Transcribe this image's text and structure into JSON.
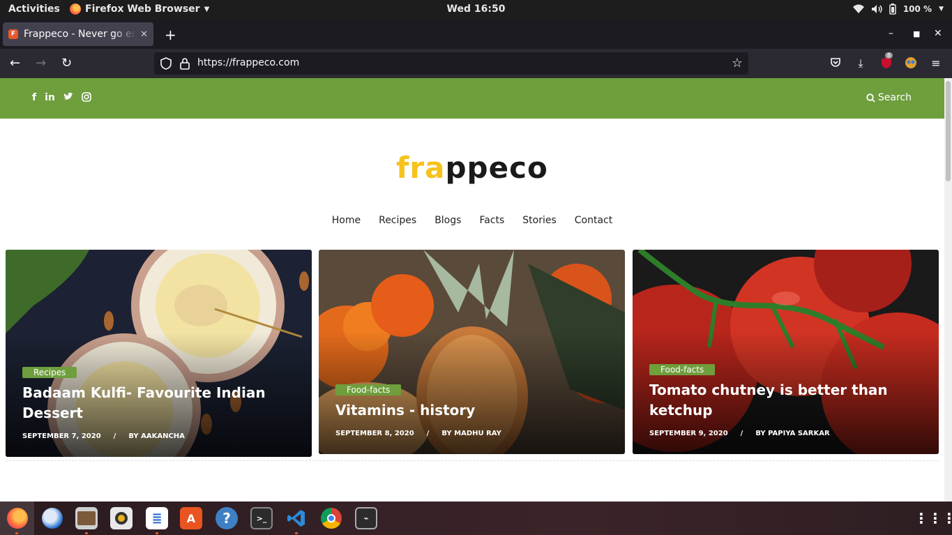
{
  "topbar": {
    "activities": "Activities",
    "app_name": "Firefox Web Browser",
    "clock": "Wed 16:50",
    "battery": "100 %"
  },
  "browser": {
    "tab_title": "Frappeco - Never go empty stomach",
    "url": "https://frappeco.com",
    "extension_badge": "8"
  },
  "site": {
    "search_label": "Search",
    "logo_part1": "fra",
    "logo_part2": "ppeco",
    "nav": [
      "Home",
      "Recipes",
      "Blogs",
      "Facts",
      "Stories",
      "Contact"
    ],
    "cards": [
      {
        "category": "Recipes",
        "title": "Badaam Kulfi- Favourite Indian Dessert",
        "date": "SEPTEMBER 7, 2020",
        "separator": "/",
        "author": "BY AAKANCHA"
      },
      {
        "category": "Food-facts",
        "title": "Vitamins - history",
        "date": "SEPTEMBER 8, 2020",
        "separator": "/",
        "author": "BY MADHU RAY"
      },
      {
        "category": "Food-facts",
        "title": "Tomato chutney is better than ketchup",
        "date": "SEPTEMBER 9, 2020",
        "separator": "/",
        "author": "BY PAPIYA SARKAR"
      }
    ]
  },
  "colors": {
    "brand_green": "#6f9e3d",
    "logo_yellow": "#f6c21c"
  }
}
